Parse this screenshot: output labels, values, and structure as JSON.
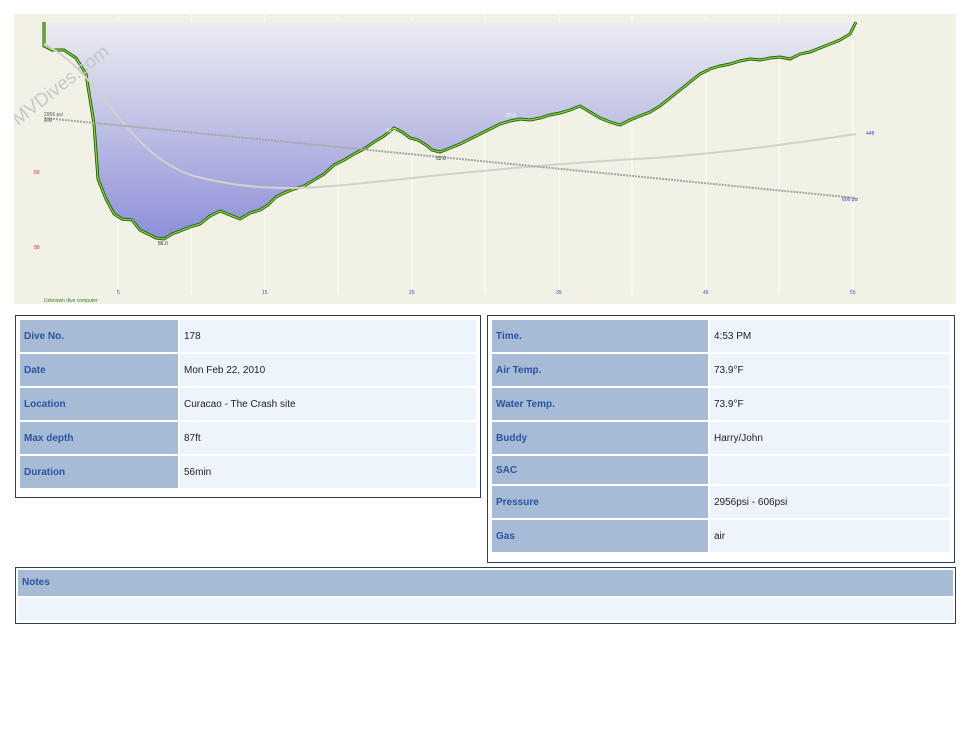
{
  "watermark": "MVDives.com",
  "profile": {
    "start_pressure_label": "2956 psi",
    "start_gas_label": "AIR",
    "end_pressure_label": "606 psi",
    "temp_label": "44ft",
    "depth_ticks": [
      "60",
      "90"
    ],
    "time_ticks": [
      "5",
      "15",
      "25",
      "35",
      "45",
      "55"
    ],
    "annotations": {
      "max_depth": "86.0",
      "peak_1": "42.0",
      "trough_1": "52.0",
      "peak_2": "37.0"
    },
    "computer_label": "Unknown dive computer",
    "colors": {
      "background": "#f2f1e5",
      "fill_top": "#ecedf1",
      "fill_bottom": "#8e8fd8",
      "depth_line": "#0f5c12",
      "depth_highlight": "#9acd32",
      "pressure_line": "#a6a6a6",
      "temp_line": "#d2d2cc"
    }
  },
  "dive": {
    "fields": [
      {
        "label": "Dive No.",
        "value": "178"
      },
      {
        "label": "Date",
        "value": "Mon Feb 22, 2010"
      },
      {
        "label": "Location",
        "value": "Curacao - The Crash site"
      },
      {
        "label": "Max depth",
        "value": "87ft"
      },
      {
        "label": "Duration",
        "value": "56min"
      }
    ]
  },
  "conditions": {
    "fields": [
      {
        "label": "Time.",
        "value": "4:53 PM"
      },
      {
        "label": "Air Temp.",
        "value": "73.9°F"
      },
      {
        "label": "Water Temp.",
        "value": "73.9°F"
      },
      {
        "label": "Buddy",
        "value": "Harry/John"
      },
      {
        "label": "SAC",
        "value": ""
      },
      {
        "label": "Pressure",
        "value": "2956psi - 606psi"
      },
      {
        "label": "Gas",
        "value": "air"
      }
    ]
  },
  "notes": {
    "label": "Notes",
    "text": ""
  }
}
